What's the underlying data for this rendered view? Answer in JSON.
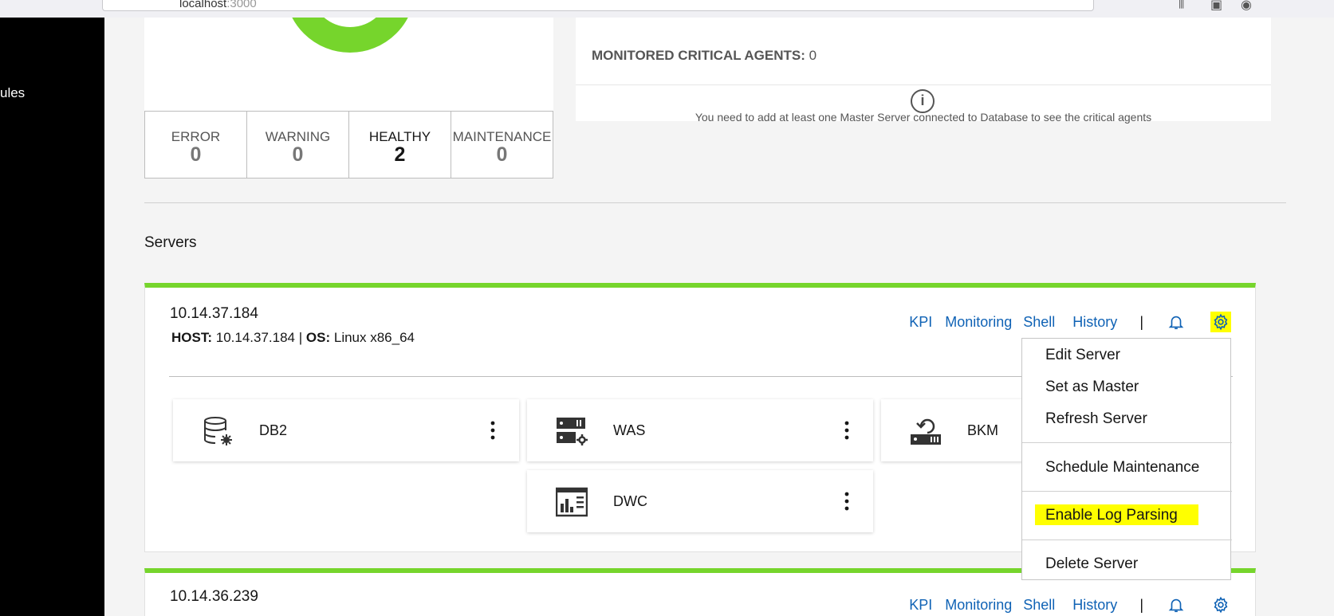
{
  "browser": {
    "url_host": "localhost",
    "url_port": ":3000"
  },
  "sidebar": {
    "items": [
      {
        "label": "ules"
      }
    ]
  },
  "health_summary": {
    "stats": [
      {
        "label": "ERROR",
        "value": "0"
      },
      {
        "label": "WARNING",
        "value": "0"
      },
      {
        "label": "HEALTHY",
        "value": "2"
      },
      {
        "label": "MAINTENANCE",
        "value": "0"
      }
    ],
    "donut_color": "#76d52c"
  },
  "critical_agents": {
    "title_label": "MONITORED CRITICAL AGENTS:",
    "title_value": "0",
    "info_icon": "info-icon",
    "message": "You need to add at least one Master Server connected to Database to see the critical agents"
  },
  "servers_section": {
    "title": "Servers",
    "accent_color": "#76d52c",
    "link_color": "#0f62b5",
    "action_labels": {
      "kpi": "KPI",
      "monitoring": "Monitoring",
      "shell": "Shell",
      "history": "History",
      "separator": "|"
    },
    "servers": [
      {
        "ip": "10.14.37.184",
        "host_label": "HOST:",
        "host_value": "10.14.37.184",
        "meta_sep": "|",
        "os_label": "OS:",
        "os_value": "Linux x86_64",
        "apps": [
          {
            "label": "DB2",
            "icon": "database-gear-icon"
          },
          {
            "label": "WAS",
            "icon": "server-gear-icon"
          },
          {
            "label": "BKM",
            "icon": "server-refresh-icon"
          },
          {
            "label": "DWC",
            "icon": "dashboard-chart-icon"
          }
        ]
      },
      {
        "ip": "10.14.36.239"
      }
    ]
  },
  "settings_menu": {
    "items": [
      {
        "label": "Edit Server"
      },
      {
        "label": "Set as Master"
      },
      {
        "label": "Refresh Server"
      },
      {
        "label": "Schedule Maintenance"
      },
      {
        "label": "Enable Log Parsing",
        "highlighted": true
      },
      {
        "label": "Delete Server"
      }
    ],
    "highlight_color": "#ffff00"
  }
}
